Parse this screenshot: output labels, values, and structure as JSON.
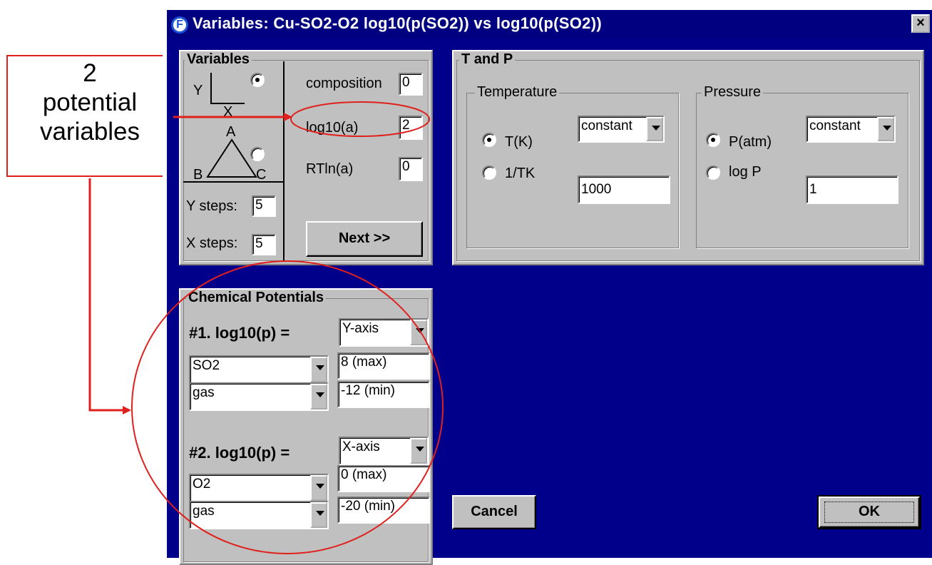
{
  "callout": {
    "lines": [
      "2",
      "potential",
      "variables"
    ],
    "color": "#e0201c"
  },
  "window": {
    "title": "Variables:  Cu-SO2-O2  log10(p(SO2)) vs log10(p(SO2))",
    "app_icon": "F",
    "close_label": "×",
    "background": "#00008a"
  },
  "variables": {
    "group_title": "Variables",
    "axis_y": "Y",
    "axis_x": "X",
    "tri_a": "A",
    "tri_b": "B",
    "tri_c": "C",
    "composition_label": "composition",
    "composition_value": "0",
    "log10a_label": "log10(a)",
    "log10a_value": "2",
    "rtlna_label": "RTln(a)",
    "rtlna_value": "0",
    "y_steps_label": "Y steps:",
    "y_steps_value": "5",
    "x_steps_label": "X steps:",
    "x_steps_value": "5",
    "next_label": "Next >>"
  },
  "tp": {
    "group_title": "T and P",
    "temperature": {
      "title": "Temperature",
      "option1": "T(K)",
      "option2": "1/TK",
      "mode": "constant",
      "value": "1000"
    },
    "pressure": {
      "title": "Pressure",
      "option1": "P(atm)",
      "option2": "log P",
      "mode": "constant",
      "value": "1"
    }
  },
  "chem": {
    "group_title": "Chemical Potentials",
    "p1": {
      "label": "#1.  log10(p) =",
      "axis": "Y-axis",
      "species": "SO2",
      "phase": "gas",
      "max": "8 (max)",
      "min": "-12 (min)"
    },
    "p2": {
      "label": "#2.  log10(p) =",
      "axis": "X-axis",
      "species": "O2",
      "phase": "gas",
      "max": "0 (max)",
      "min": "-20 (min)"
    }
  },
  "buttons": {
    "cancel": "Cancel",
    "ok": "OK"
  }
}
